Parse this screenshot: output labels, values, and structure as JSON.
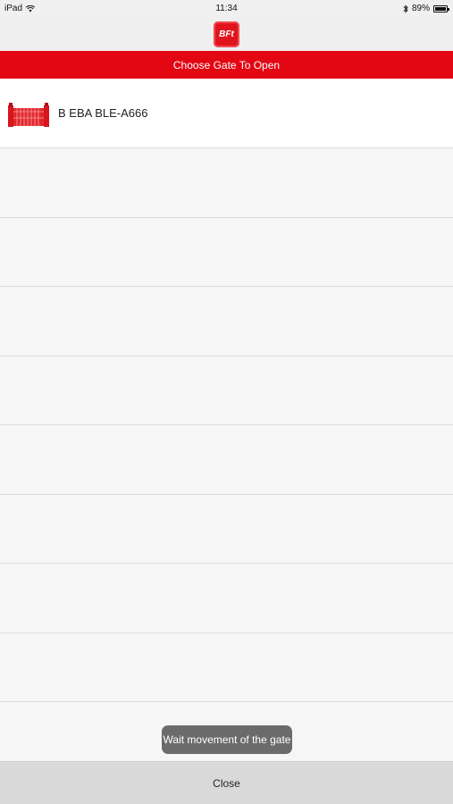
{
  "status_bar": {
    "device": "iPad",
    "wifi_icon": "wifi-icon",
    "time": "11:34",
    "bluetooth_icon": "bluetooth-icon",
    "battery_percent": "89%",
    "battery_level": 0.89
  },
  "nav": {
    "logo_text": "BFt"
  },
  "header": {
    "title": "Choose Gate To Open"
  },
  "gates": [
    {
      "label": "B EBA BLE-A666",
      "icon": "gate-icon"
    }
  ],
  "empty_rows": 9,
  "toast": {
    "text": "Wait movement of the gate"
  },
  "footer": {
    "close_label": "Close"
  },
  "colors": {
    "brand_red": "#e30613",
    "toast_bg": "#6b6b6b",
    "footer_bg": "#d9d9d9"
  }
}
